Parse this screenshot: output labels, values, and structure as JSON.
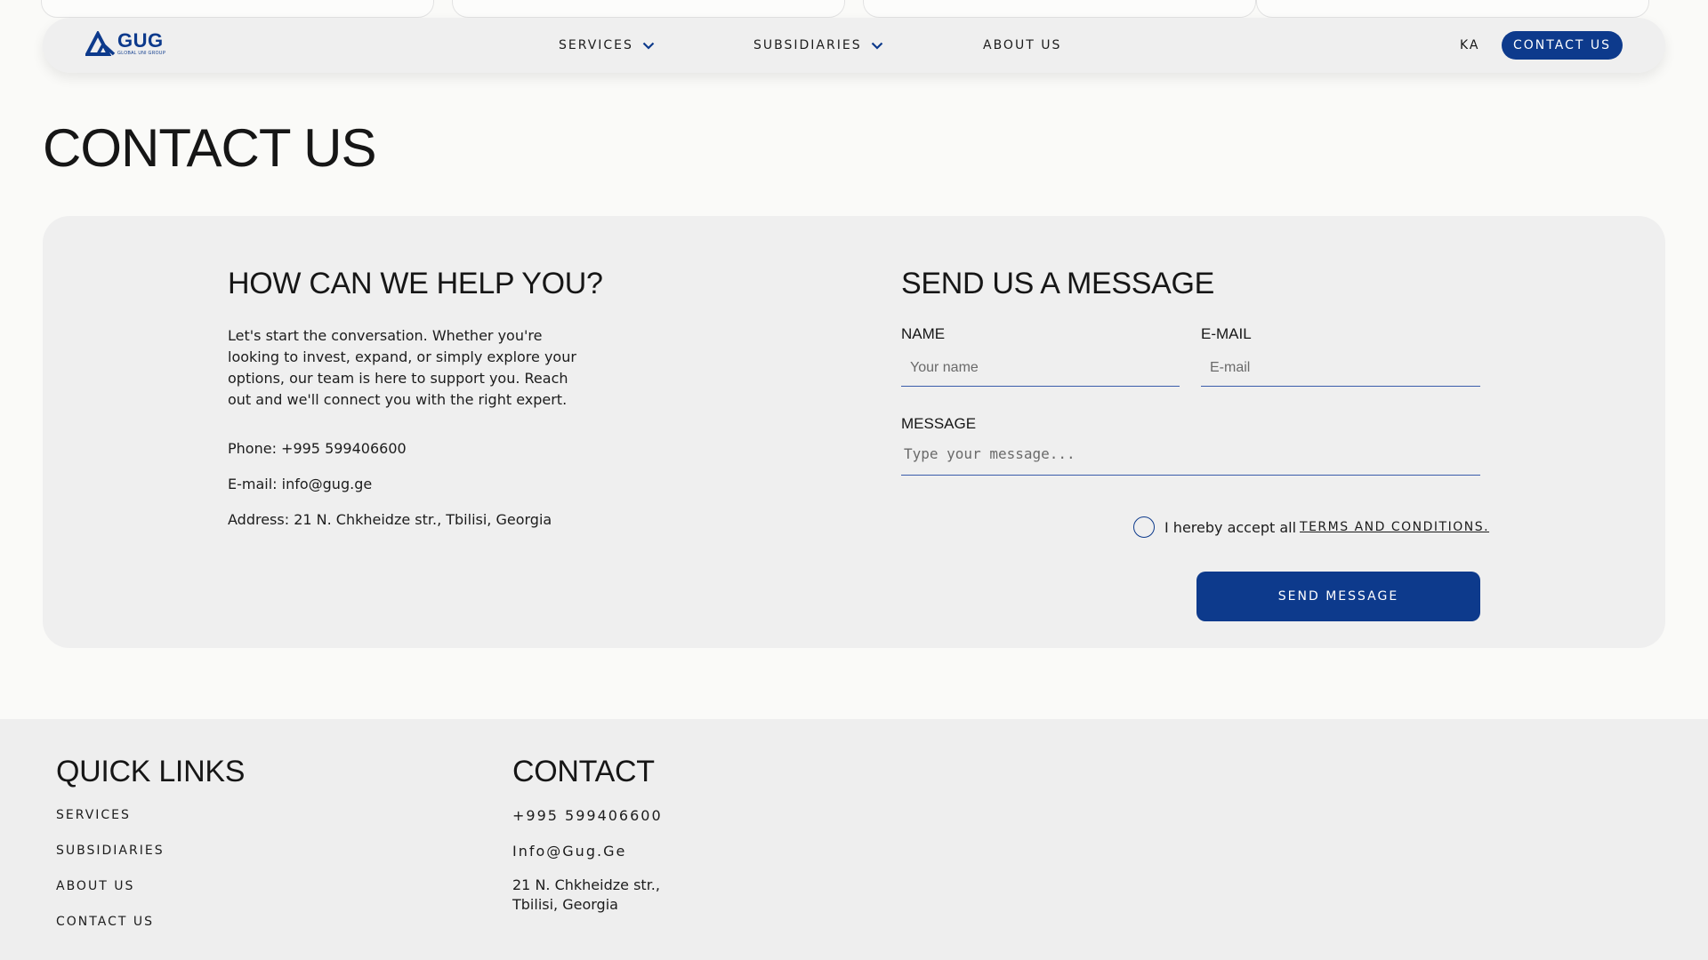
{
  "brand": {
    "logo_text": "GUG",
    "logo_subtext": "GLOBAL UNI GROUP",
    "primary_color": "#0d3a8c"
  },
  "nav": {
    "items": [
      {
        "label": "SERVICES",
        "has_dropdown": true
      },
      {
        "label": "SUBSIDIARIES",
        "has_dropdown": true
      },
      {
        "label": "ABOUT US",
        "has_dropdown": false
      }
    ],
    "language": "KA",
    "contact_button": "CONTACT US"
  },
  "page": {
    "title": "CONTACT US"
  },
  "help": {
    "heading": "HOW CAN WE HELP YOU?",
    "text": "Let's start the conversation. Whether you're looking to invest, expand, or simply explore your options, our team is here to support you. Reach out and we'll connect you with the right expert.",
    "phone": "Phone: +995 599406600",
    "email": "E-mail: info@gug.ge",
    "address": "Address: 21 N. Chkheidze str., Tbilisi, Georgia"
  },
  "form": {
    "heading": "SEND US A MESSAGE",
    "name_label": "NAME",
    "name_placeholder": "Your name",
    "email_label": "E-MAIL",
    "email_placeholder": "E-mail",
    "message_label": "MESSAGE",
    "message_placeholder": "Type your message...",
    "terms_text": "I hereby accept all",
    "terms_link": "TERMS AND CONDITIONS.",
    "submit_label": "SEND MESSAGE"
  },
  "footer": {
    "quick_links_heading": "QUICK LINKS",
    "quick_links": [
      "SERVICES",
      "SUBSIDIARIES",
      "ABOUT US",
      "CONTACT US"
    ],
    "contact_heading": "CONTACT",
    "phone": "+995 599406600",
    "email": "Info@Gug.Ge",
    "address_line1": "21 N. Chkheidze str.,",
    "address_line2": "Tbilisi, Georgia"
  }
}
